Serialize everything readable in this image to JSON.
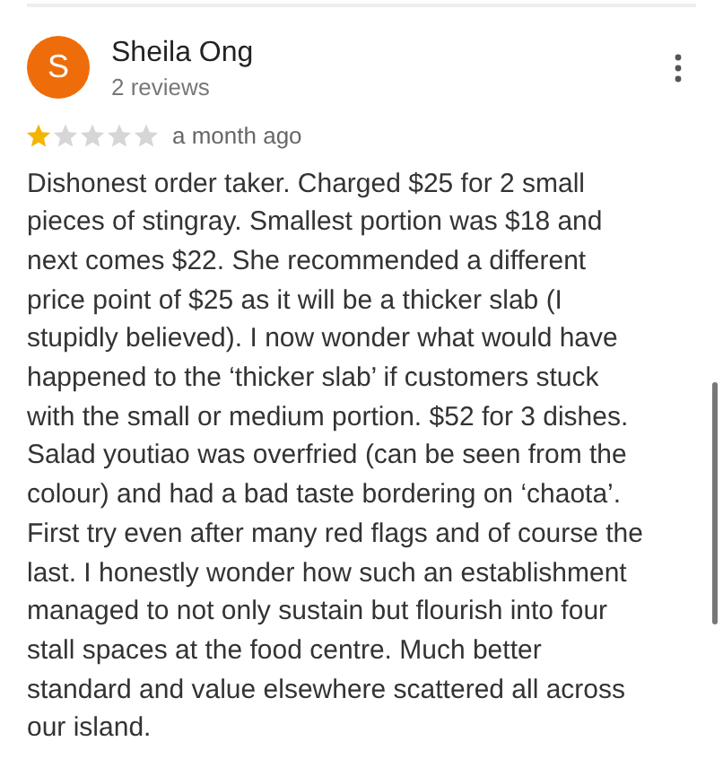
{
  "reviewer": {
    "initial": "S",
    "name": "Sheila Ong",
    "review_count": "2 reviews"
  },
  "rating": {
    "stars": 1,
    "time": "a month ago"
  },
  "review_text": "Dishonest order taker. Charged $25 for 2 small pieces of stingray. Smallest portion was $18 and next comes $22. She recommended a different price point of $25 as it will be a thicker slab (I stupidly believed). I now wonder what would have happened to the ‘thicker slab’ if customers stuck with the small or medium portion. $52 for 3 dishes. Salad youtiao was overfried (can be seen from the colour) and had a bad taste bordering on ‘chaota’. First try even after many red flags and of course the last. I honestly wonder how such an establishment managed to not only sustain but flourish into four stall spaces at the food centre. Much better standard and value elsewhere scattered all across our island."
}
